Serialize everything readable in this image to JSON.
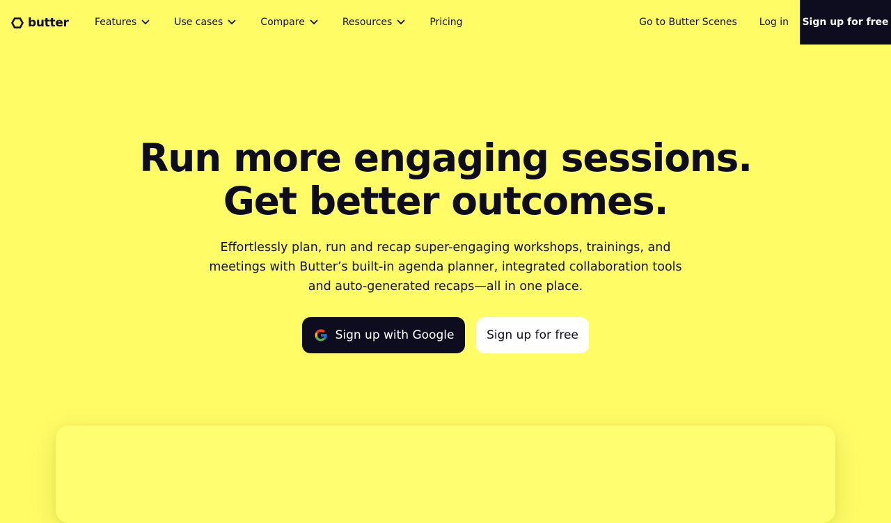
{
  "brand": {
    "name": "butter"
  },
  "nav": {
    "menu": [
      {
        "label": "Features",
        "has_dropdown": true
      },
      {
        "label": "Use cases",
        "has_dropdown": true
      },
      {
        "label": "Compare",
        "has_dropdown": true
      },
      {
        "label": "Resources",
        "has_dropdown": true
      },
      {
        "label": "Pricing",
        "has_dropdown": false
      }
    ],
    "scenes_link": "Go to Butter Scenes",
    "login_link": "Log in",
    "signup_button": "Sign up for free"
  },
  "hero": {
    "headline_line1": "Run more engaging sessions.",
    "headline_line2": "Get better outcomes.",
    "subtext": "Effortlessly plan, run and recap super-engaging workshops, trainings, and meetings with Butter’s built-in agenda planner, integrated collaboration tools and auto-generated recaps—all in one place.",
    "google_button": "Sign up with Google",
    "free_button": "Sign up for free"
  },
  "icons": {
    "logo": "butter-hexagon-logo-icon",
    "dropdown": "chevron-down-icon",
    "google": "google-g-icon"
  },
  "colors": {
    "background": "#FFFC66",
    "dark": "#0D0D1F",
    "white": "#FFFFFF"
  }
}
